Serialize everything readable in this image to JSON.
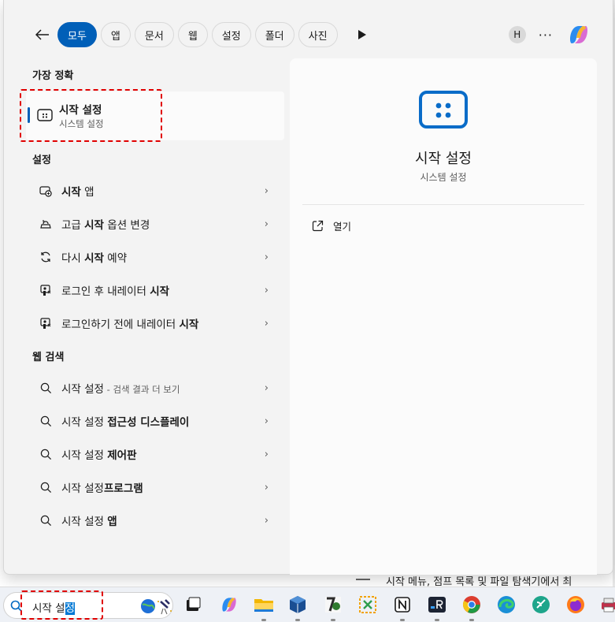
{
  "filters": {
    "tabs": [
      {
        "label": "모두",
        "active": true
      },
      {
        "label": "앱",
        "active": false
      },
      {
        "label": "문서",
        "active": false
      },
      {
        "label": "웹",
        "active": false
      },
      {
        "label": "설정",
        "active": false
      },
      {
        "label": "폴더",
        "active": false
      },
      {
        "label": "사진",
        "active": false
      }
    ],
    "avatar_initial": "H",
    "more_label": "···"
  },
  "best_match": {
    "section_title": "가장 정확",
    "title": "시작 설정",
    "subtitle": "시스템 설정"
  },
  "settings_section": {
    "title": "설정",
    "items": [
      {
        "pre": "",
        "bold": "시작",
        "post": " 앱",
        "icon": "start-app-icon"
      },
      {
        "pre": "고급 ",
        "bold": "시작",
        "post": " 옵션 변경",
        "icon": "recovery-icon"
      },
      {
        "pre": "다시 ",
        "bold": "시작",
        "post": " 예약",
        "icon": "refresh-icon"
      },
      {
        "pre": "로그인 후 내레이터 ",
        "bold": "시작",
        "post": "",
        "icon": "narrator-icon"
      },
      {
        "pre": "로그인하기 전에 내레이터 ",
        "bold": "시작",
        "post": "",
        "icon": "narrator-icon"
      }
    ]
  },
  "web_section": {
    "title": "웹 검색",
    "items": [
      {
        "pre": "시작 설정",
        "bold": "",
        "suffix": " - 검색 결과 더 보기"
      },
      {
        "pre": "시작 설정 ",
        "bold": "접근성 디스플레이",
        "suffix": ""
      },
      {
        "pre": "시작 설정 ",
        "bold": "제어판",
        "suffix": ""
      },
      {
        "pre": "시작 설정",
        "bold": "프로그램",
        "suffix": ""
      },
      {
        "pre": "시작 설정 ",
        "bold": "앱",
        "suffix": ""
      }
    ]
  },
  "preview": {
    "title": "시작 설정",
    "subtitle": "시스템 설정",
    "open_label": "열기"
  },
  "taskbar": {
    "search_text_plain": "시작 설",
    "search_text_selected": "정"
  },
  "background_doc": {
    "visible_text": "시작 메뉴, 점프 목록 및 파일 탐색기에서 최"
  },
  "colors": {
    "accent": "#005fb8",
    "highlight": "#e00000"
  }
}
